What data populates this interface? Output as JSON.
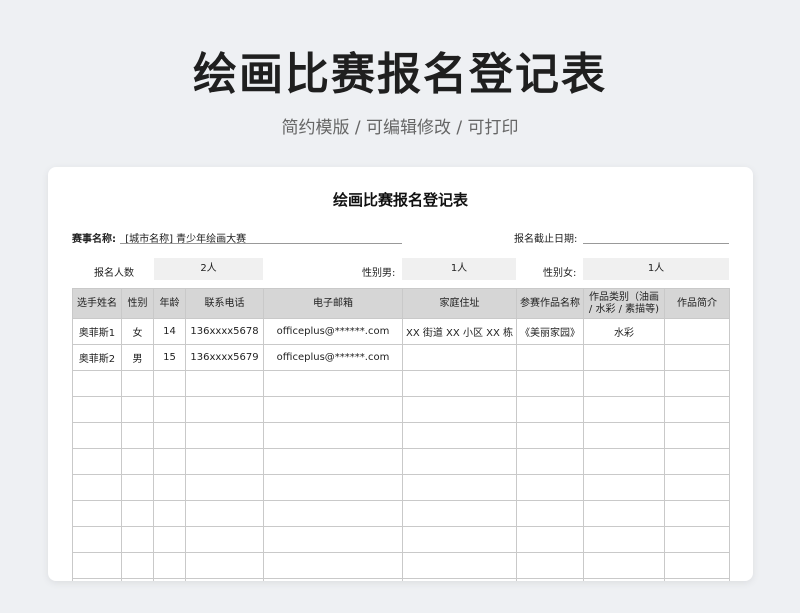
{
  "hero": {
    "title": "绘画比赛报名登记表",
    "subtitle": "简约模版 /  可编辑修改  / 可打印"
  },
  "sheet": {
    "title": "绘画比赛报名登记表",
    "event_label": "赛事名称:",
    "event_value": "[城市名称] 青少年绘画大赛",
    "deadline_label": "报名截止日期:",
    "deadline_value": "",
    "summary": {
      "count_label": "报名人数",
      "count_value": "2人",
      "male_label": "性别男:",
      "male_value": "1人",
      "female_label": "性别女:",
      "female_value": "1人"
    },
    "columns": [
      "选手姓名",
      "性别",
      "年龄",
      "联系电话",
      "电子邮箱",
      "家庭住址",
      "参赛作品名称",
      "作品类别（油画 / 水彩 / 素描等)",
      "作品简介"
    ],
    "rows": [
      [
        "奥菲斯1",
        "女",
        "14",
        "136xxxx5678",
        "officeplus@******.com",
        "XX 街道 XX 小区 XX 栋",
        "《美丽家园》",
        "水彩",
        ""
      ],
      [
        "奥菲斯2",
        "男",
        "15",
        "136xxxx5679",
        "officeplus@******.com",
        "",
        "",
        "",
        ""
      ]
    ],
    "empty_rows": 9
  }
}
